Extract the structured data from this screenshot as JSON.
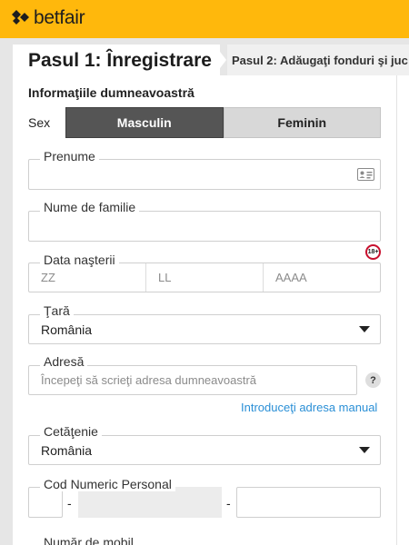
{
  "brand": {
    "name": "betfair",
    "accent": "#ffb80c",
    "logo_icon": "betfair-diamonds-icon"
  },
  "steps": [
    {
      "label": "Pasul 1: Înregistrare"
    },
    {
      "label": "Pasul 2: Adăugaţi fonduri şi juc"
    }
  ],
  "form": {
    "section_title": "Informaţiile dumneavoastră",
    "sex": {
      "label": "Sex",
      "options": [
        "Masculin",
        "Feminin"
      ],
      "selected": "Masculin"
    },
    "first_name": {
      "label": "Prenume",
      "value": "",
      "icon": "id-card-icon"
    },
    "last_name": {
      "label": "Nume de familie",
      "value": ""
    },
    "birth_date": {
      "label": "Data naşterii",
      "day_placeholder": "ZZ",
      "month_placeholder": "LL",
      "year_placeholder": "AAAA",
      "age_badge": "18+"
    },
    "country": {
      "label": "Ţară",
      "value": "România"
    },
    "address": {
      "label": "Adresă",
      "placeholder": "Începeţi să scrieţi adresa dumneavoastră",
      "help": "?",
      "manual_link": "Introduceţi adresa manual"
    },
    "citizenship": {
      "label": "Cetăţenie",
      "value": "România"
    },
    "cnp": {
      "label": "Cod Numeric Personal",
      "separator": "-"
    },
    "mobile": {
      "label": "Număr de mobil"
    }
  }
}
